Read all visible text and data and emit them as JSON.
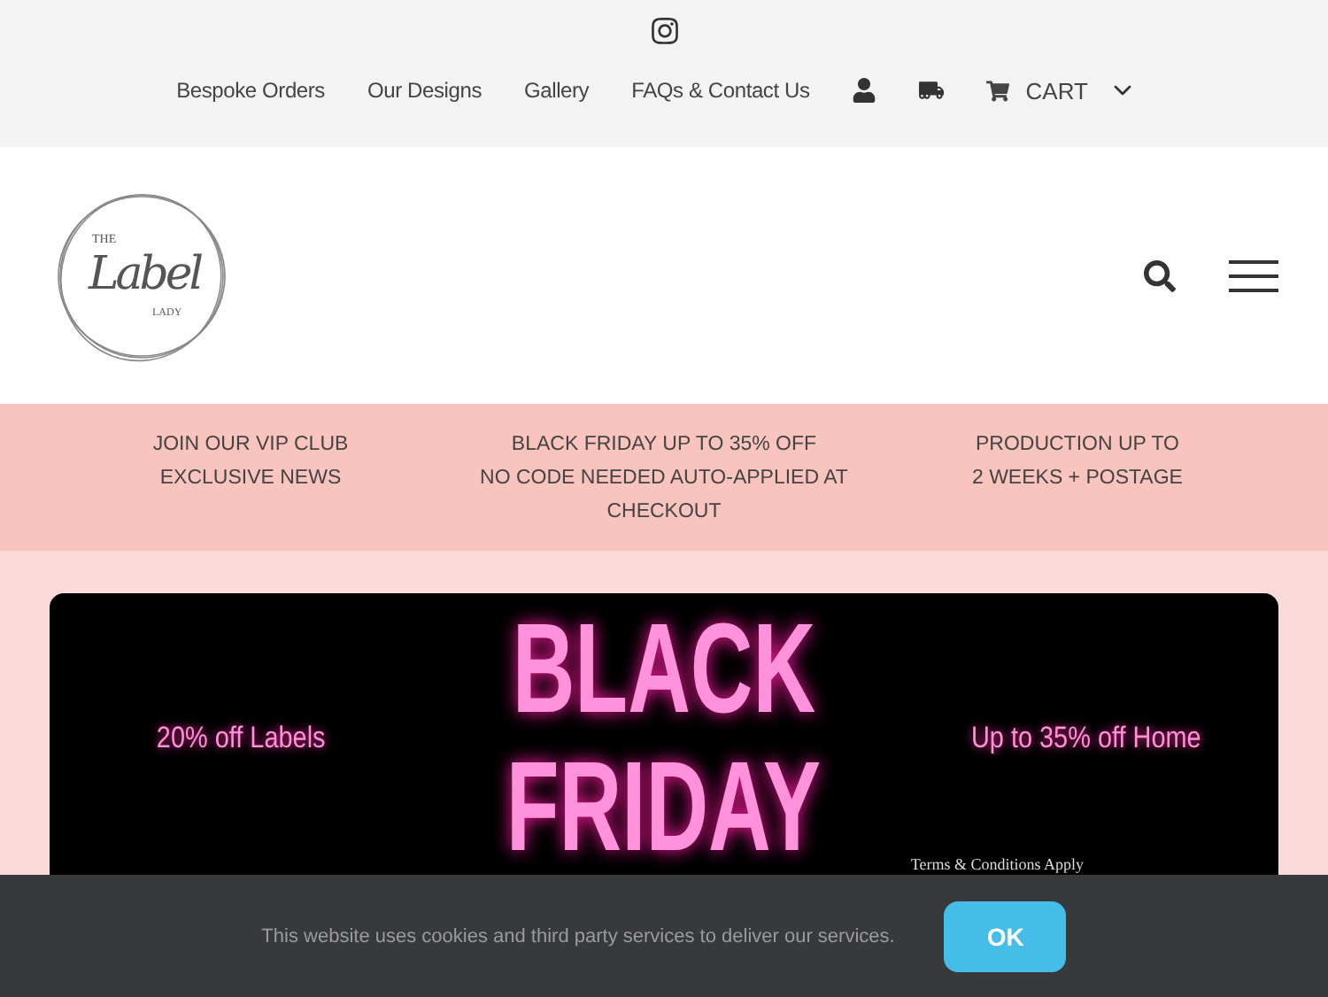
{
  "top_bar": {
    "nav": [
      {
        "kind": "link",
        "label": "Bespoke Orders"
      },
      {
        "kind": "link",
        "label": "Our Designs"
      },
      {
        "kind": "link",
        "label": "Gallery"
      },
      {
        "kind": "link",
        "label": "FAQs & Contact Us"
      },
      {
        "kind": "account"
      },
      {
        "kind": "delivery"
      },
      {
        "kind": "cart",
        "label": "CART"
      }
    ]
  },
  "logo": {
    "top": "THE",
    "main": "Label",
    "bottom": "LADY"
  },
  "promo_strip": [
    {
      "lines": [
        "JOIN OUR VIP CLUB",
        "EXCLUSIVE NEWS"
      ]
    },
    {
      "lines": [
        "BLACK FRIDAY UP TO 35% OFF",
        "NO CODE NEEDED AUTO-APPLIED AT CHECKOUT"
      ]
    },
    {
      "lines": [
        "PRODUCTION UP TO",
        "2 WEEKS + POSTAGE"
      ]
    }
  ],
  "banner": {
    "left": "20% off Labels",
    "headline": [
      "BLACK",
      "FRIDAY"
    ],
    "right": "Up to 35% off Home",
    "terms": "Terms & Conditions Apply"
  },
  "cookie_bar": {
    "message": "This website uses cookies and third party services to deliver our services.",
    "button": "OK"
  }
}
